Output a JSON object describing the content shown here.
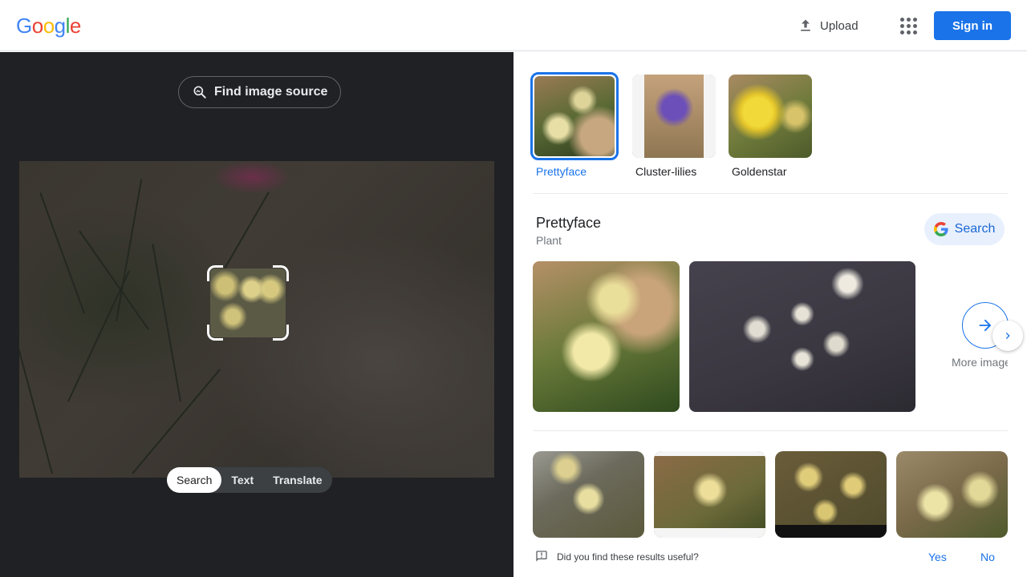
{
  "header": {
    "logo_letters": [
      {
        "ch": "G",
        "color": "#4285F4"
      },
      {
        "ch": "o",
        "color": "#EA4335"
      },
      {
        "ch": "o",
        "color": "#FBBC05"
      },
      {
        "ch": "g",
        "color": "#4285F4"
      },
      {
        "ch": "l",
        "color": "#34A853"
      },
      {
        "ch": "e",
        "color": "#EA4335"
      }
    ],
    "upload_label": "Upload",
    "signin_label": "Sign in"
  },
  "left": {
    "find_source_label": "Find image source",
    "modes": [
      {
        "label": "Search",
        "active": true
      },
      {
        "label": "Text",
        "active": false
      },
      {
        "label": "Translate",
        "active": false
      }
    ]
  },
  "right": {
    "suggestions": [
      {
        "label": "Prettyface",
        "selected": true
      },
      {
        "label": "Cluster-lilies",
        "selected": false
      },
      {
        "label": "Goldenstar",
        "selected": false
      }
    ],
    "entity": {
      "title": "Prettyface",
      "subtitle": "Plant",
      "search_label": "Search"
    },
    "more_images_label": "More images",
    "feedback": {
      "question": "Did you find these results useful?",
      "yes": "Yes",
      "no": "No"
    }
  },
  "colors": {
    "accent": "#1a73e8",
    "dark_panel": "#202124"
  }
}
